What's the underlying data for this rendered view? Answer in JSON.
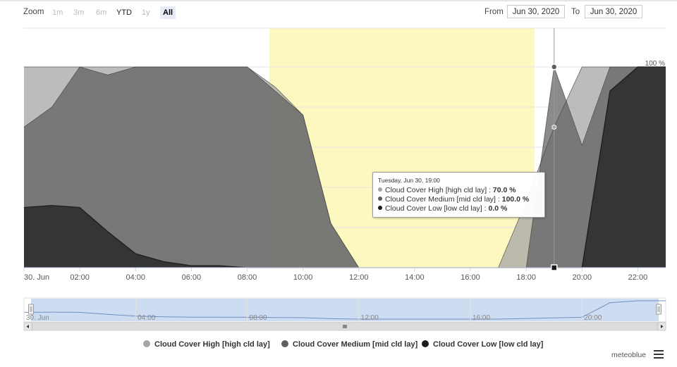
{
  "toolbar": {
    "zoom_label": "Zoom",
    "buttons": [
      "1m",
      "3m",
      "6m",
      "YTD",
      "1y",
      "All"
    ],
    "selected": "All",
    "from_label": "From",
    "to_label": "To",
    "from_value": "Jun 30, 2020",
    "to_value": "Jun 30, 2020"
  },
  "colors": {
    "high": "#a5a5a5",
    "medium": "#5e5e5e",
    "low": "#1c1c1c",
    "night_band": "#fdf8c0",
    "navigator_mask": "#c8d8ee"
  },
  "chart_data": {
    "type": "area",
    "x_unit": "hour of Jun 30",
    "x_tick_labels": [
      "30. Jun",
      "02:00",
      "04:00",
      "06:00",
      "08:00",
      "10:00",
      "12:00",
      "14:00",
      "16:00",
      "18:00",
      "20:00",
      "22:00"
    ],
    "x_tick_hours": [
      0,
      2,
      4,
      6,
      8,
      10,
      12,
      14,
      16,
      18,
      20,
      22
    ],
    "xlim": [
      0,
      23
    ],
    "ylim": [
      0,
      100
    ],
    "y_max_label": "100 %",
    "band": {
      "from": 8.8,
      "to": 18.3
    },
    "series": [
      {
        "name": "Cloud Cover High [high cld lay]",
        "x": [
          0,
          1,
          2,
          3,
          4,
          5,
          6,
          7,
          8,
          9,
          10,
          11,
          12,
          13,
          14,
          15,
          16,
          17,
          18,
          19,
          20,
          21,
          22,
          23
        ],
        "values": [
          100,
          100,
          100,
          100,
          100,
          100,
          100,
          100,
          100,
          90,
          76,
          22,
          0,
          0,
          0,
          0,
          0,
          0,
          33,
          70,
          100,
          100,
          100,
          100
        ]
      },
      {
        "name": "Cloud Cover Medium [mid cld lay]",
        "x": [
          0,
          1,
          2,
          3,
          4,
          5,
          6,
          7,
          8,
          9,
          10,
          11,
          12,
          13,
          14,
          15,
          16,
          17,
          18,
          19,
          20,
          21,
          22,
          23
        ],
        "values": [
          70,
          80,
          100,
          96,
          100,
          100,
          100,
          100,
          100,
          88,
          76,
          22,
          0,
          0,
          0,
          0,
          0,
          0,
          0,
          100,
          61,
          100,
          100,
          100
        ]
      },
      {
        "name": "Cloud Cover Low [low cld lay]",
        "x": [
          0,
          1,
          2,
          3,
          4,
          5,
          6,
          7,
          8,
          9,
          10,
          11,
          12,
          13,
          14,
          15,
          16,
          17,
          18,
          19,
          20,
          21,
          22,
          23
        ],
        "values": [
          30,
          31,
          30,
          18,
          7,
          3,
          1,
          1,
          0,
          0,
          0,
          0,
          0,
          0,
          0,
          0,
          0,
          0,
          0,
          0,
          0,
          88,
          100,
          100
        ]
      }
    ],
    "tooltip": {
      "header": "Tuesday, Jun 30, 19:00",
      "hour": 19,
      "rows": [
        {
          "label": "Cloud Cover High [high cld lay] : ",
          "value": "70.0 %"
        },
        {
          "label": "Cloud Cover Medium [mid cld lay] : ",
          "value": "100.0 %"
        },
        {
          "label": "Cloud Cover Low [low cld lay] : ",
          "value": "0.0 %"
        }
      ]
    },
    "navigator": {
      "tick_labels": [
        "30. Jun",
        "04:00",
        "08:00",
        "12:00",
        "16:00",
        "20:00"
      ],
      "tick_hours": [
        0,
        4,
        8,
        12,
        16,
        20
      ]
    }
  },
  "legend": [
    "Cloud Cover High [high cld lay]",
    "Cloud Cover Medium [mid cld lay]",
    "Cloud Cover Low [low cld lay]"
  ],
  "credits": "meteoblue",
  "icons": {
    "menu": "hamburger-menu-icon",
    "scroll_left": "arrow-left-icon",
    "scroll_right": "arrow-right-icon",
    "grip": "grip-icon"
  }
}
